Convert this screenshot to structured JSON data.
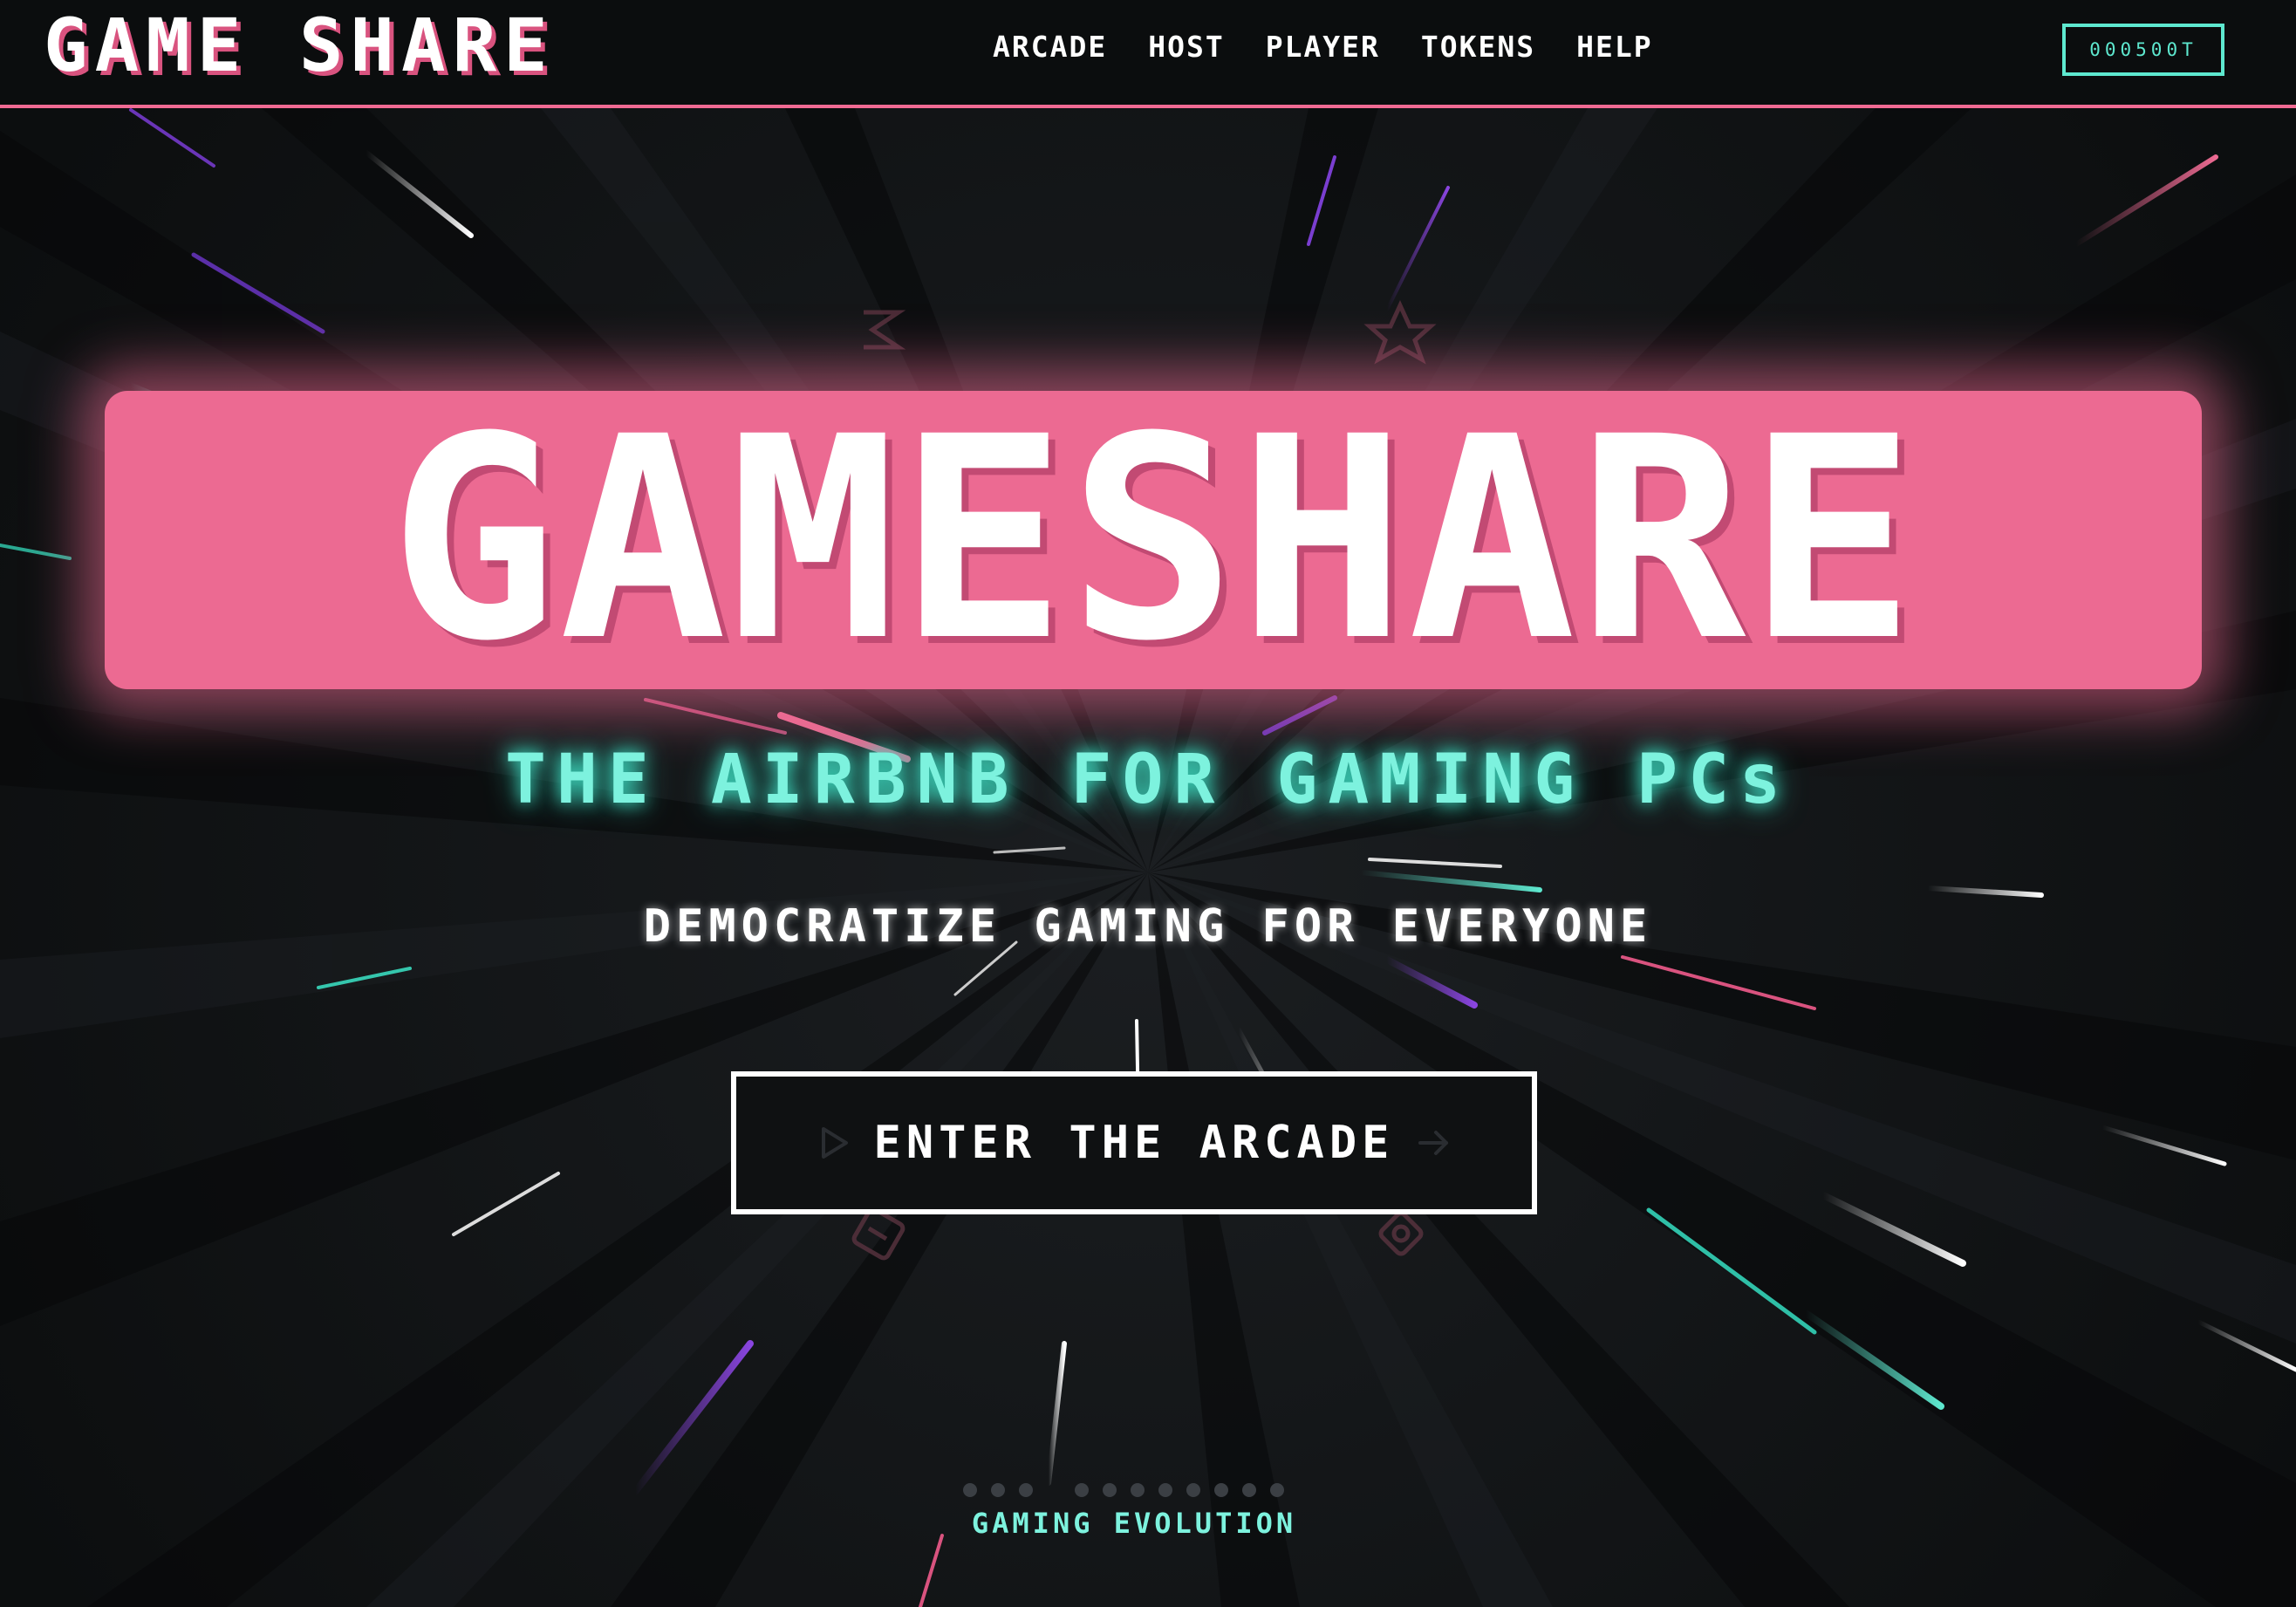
{
  "header": {
    "logo": "GAME SHARE",
    "nav": [
      "ARCADE",
      "HOST",
      "PLAYER",
      "TOKENS",
      "HELP"
    ],
    "token_balance": "000500T"
  },
  "hero": {
    "title": "GAMESHARE",
    "tagline": "THE AIRBNB FOR GAMING PCs",
    "subtitle": "DEMOCRATIZE GAMING FOR EVERYONE",
    "cta_label": "ENTER THE ARCADE",
    "cta_icons": [
      "play-icon",
      "arrow-right-icon"
    ],
    "decorations": [
      "lightning-icon",
      "star-icon",
      "gamepad-icon",
      "gear-icon"
    ]
  },
  "pager": {
    "dots": 11,
    "label": "GAMING EVOLUTION"
  },
  "colors": {
    "background": "#0f1112",
    "pink": "#ec6a92",
    "teal": "#7df2de",
    "purple": "#8a45e0",
    "white": "#ffffff"
  }
}
